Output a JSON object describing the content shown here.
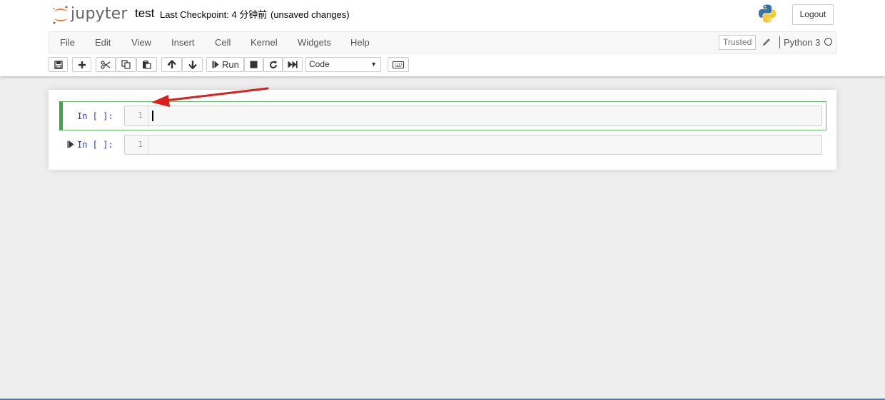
{
  "header": {
    "logo_text": "jupyter",
    "notebook_name": "test",
    "checkpoint": "Last Checkpoint: 4 分钟前",
    "autosave_status": "(unsaved changes)",
    "logout_label": "Logout"
  },
  "menubar": {
    "items": [
      "File",
      "Edit",
      "View",
      "Insert",
      "Cell",
      "Kernel",
      "Widgets",
      "Help"
    ],
    "trusted_label": "Trusted",
    "kernel_name": "Python 3"
  },
  "toolbar": {
    "run_label": "Run",
    "cell_type": "Code",
    "icons": [
      "save-icon",
      "plus-icon",
      "cut-icon",
      "copy-icon",
      "paste-icon",
      "arrow-up-icon",
      "arrow-down-icon",
      "step-forward-icon",
      "stop-icon",
      "restart-icon",
      "fast-forward-icon",
      "keyboard-icon"
    ]
  },
  "cells": [
    {
      "prompt": "In [ ]:",
      "line_number": "1",
      "selected": true
    },
    {
      "prompt": "In [ ]:",
      "line_number": "1",
      "selected": false
    }
  ],
  "colors": {
    "selected_border": "#42a548",
    "prompt": "#303f9f",
    "annotation_arrow": "#e02020"
  }
}
